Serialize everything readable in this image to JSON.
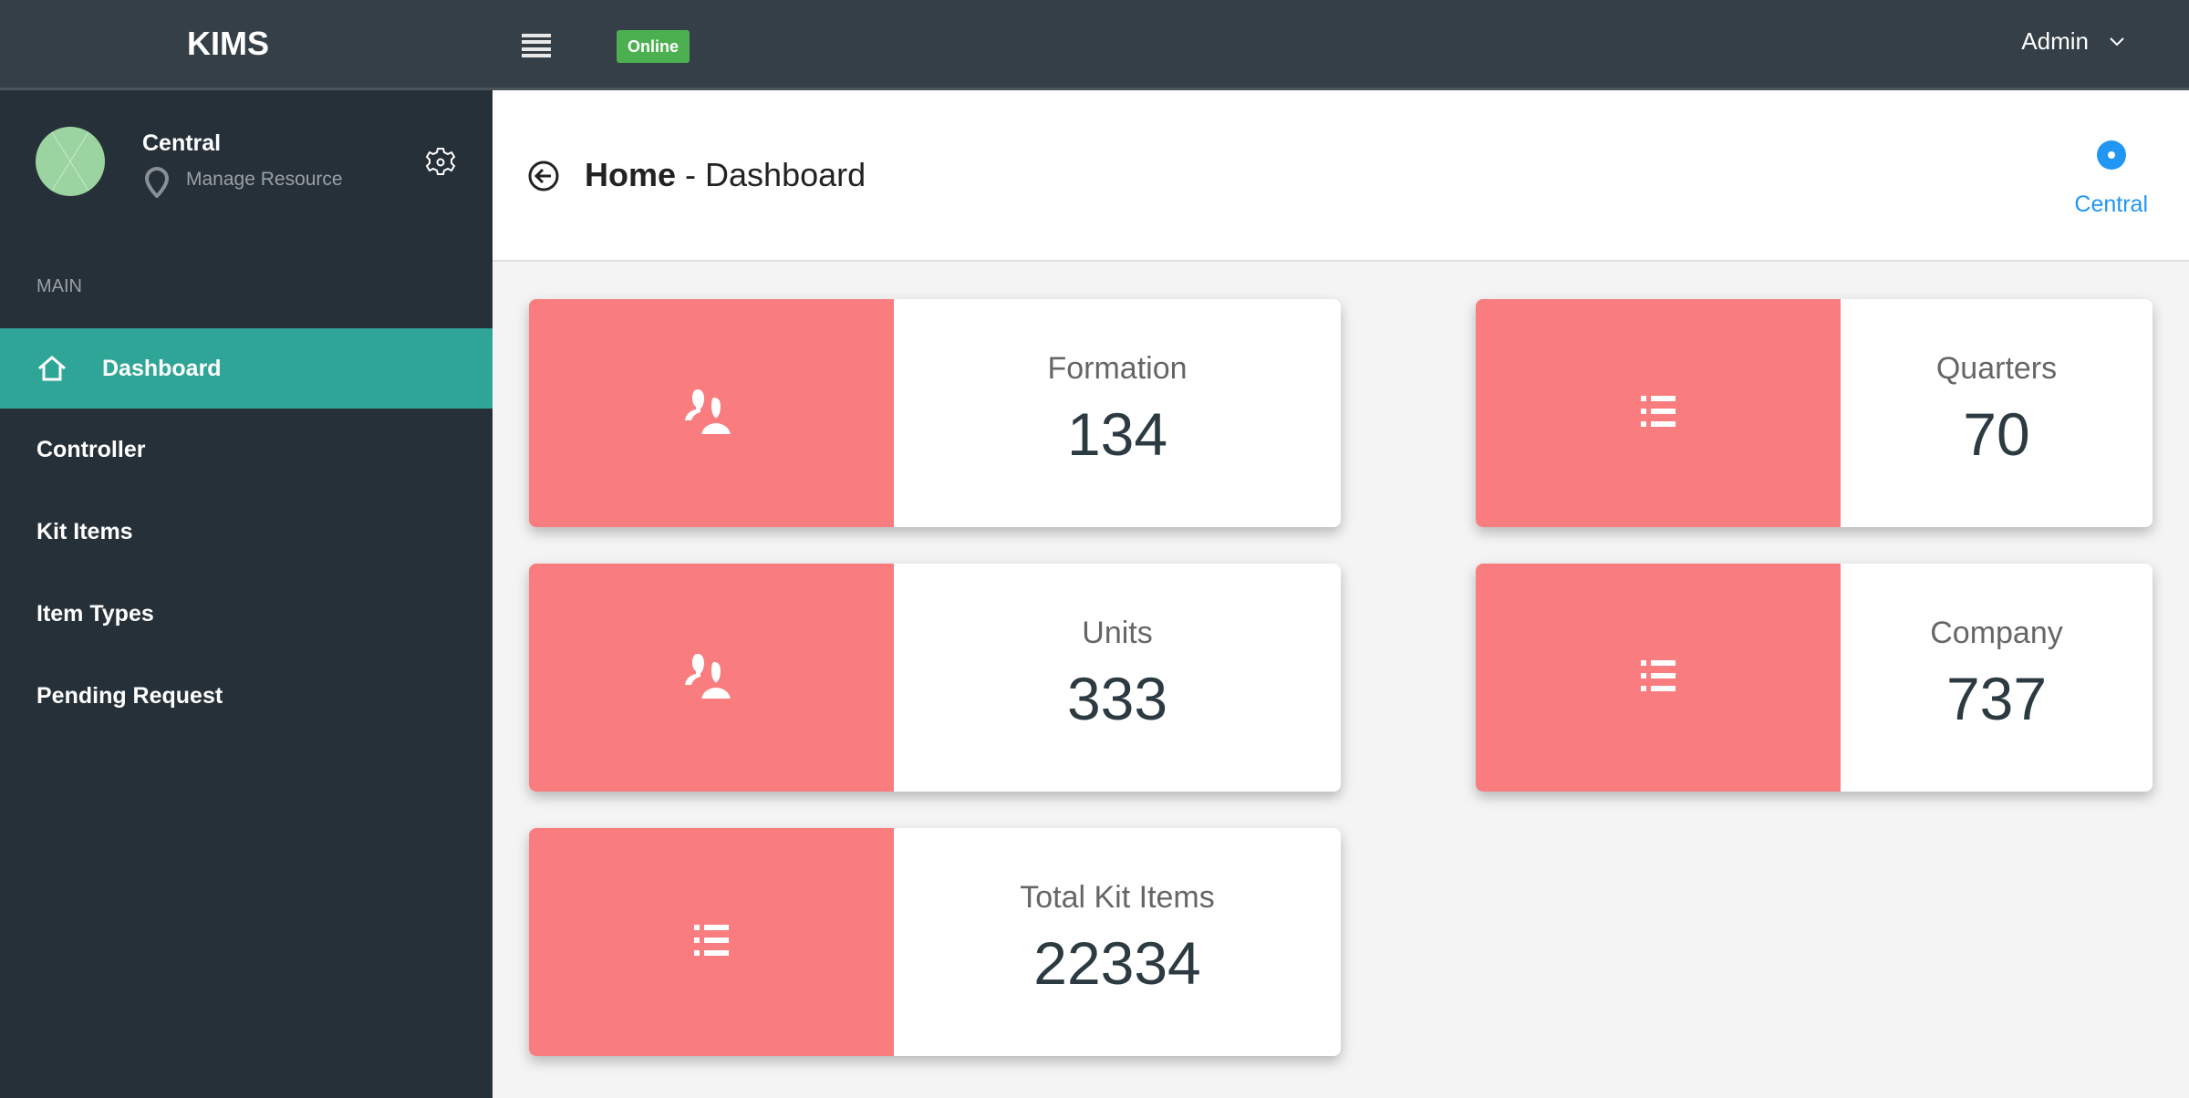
{
  "topbar": {
    "brand": "KIMS",
    "status": "Online",
    "user": "Admin"
  },
  "sidebar": {
    "profile_name": "Central",
    "profile_sub": "Manage Resource",
    "section": "MAIN",
    "items": [
      {
        "label": "Dashboard",
        "active": true
      },
      {
        "label": "Controller"
      },
      {
        "label": "Kit Items"
      },
      {
        "label": "Item Types"
      },
      {
        "label": "Pending Request"
      }
    ]
  },
  "header": {
    "title_bold": "Home",
    "title_rest": " - Dashboard",
    "location": "Central"
  },
  "cards": [
    {
      "title": "Formation",
      "value": "134",
      "icon": "users-icon"
    },
    {
      "title": "Quarters",
      "value": "70",
      "icon": "list-icon"
    },
    {
      "title": "Units",
      "value": "333",
      "icon": "users-icon"
    },
    {
      "title": "Company",
      "value": "737",
      "icon": "list-icon"
    },
    {
      "title": "Total Kit Items",
      "value": "22334",
      "icon": "list-icon"
    }
  ],
  "colors": {
    "accent": "#2fa597",
    "card": "#f97c7e",
    "online": "#4caf50",
    "location": "#2196f3"
  }
}
